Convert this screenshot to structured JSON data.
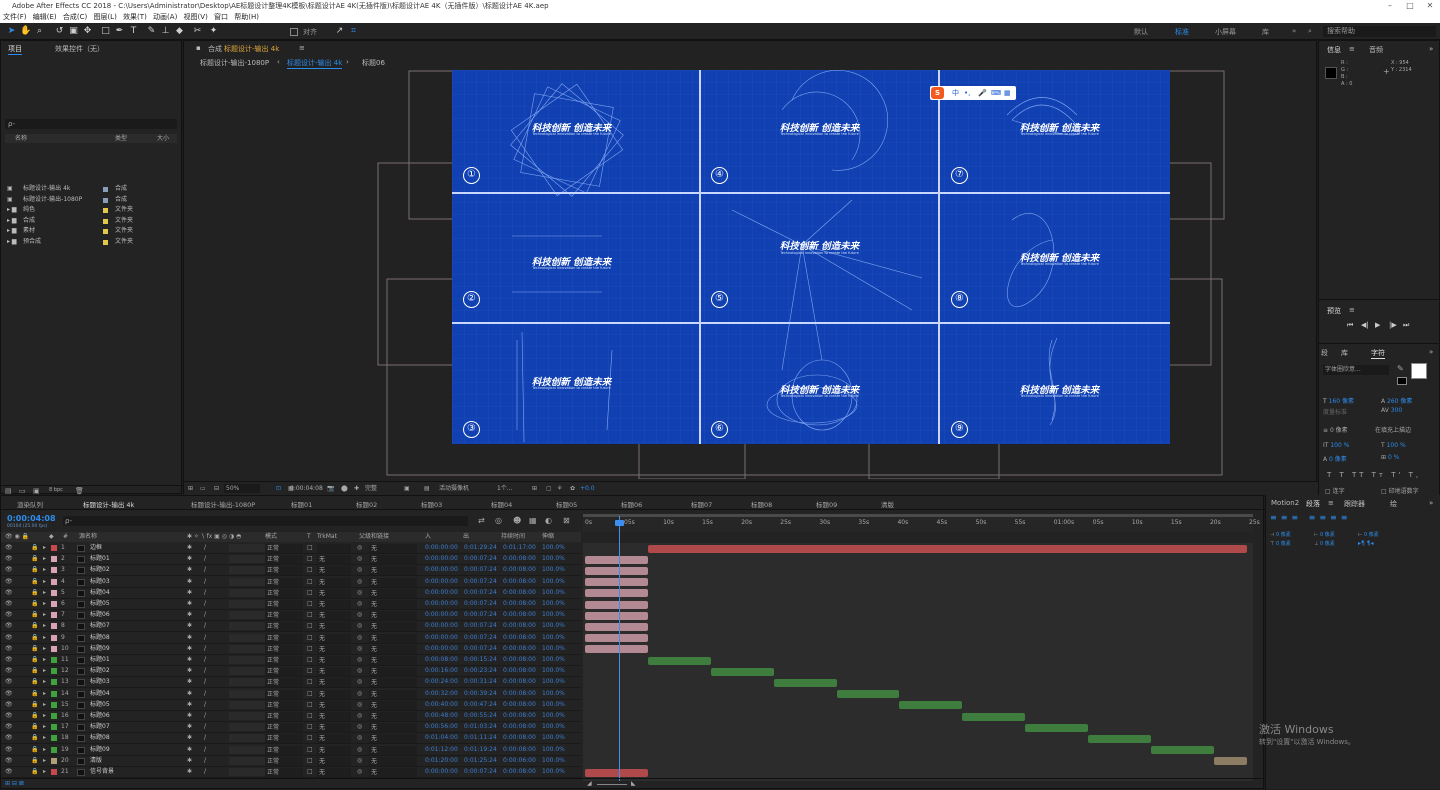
{
  "app": {
    "title": "Adobe After Effects CC 2018 - C:\\Users\\Administrator\\Desktop\\AE标题设计整理4K模板\\标题设计AE 4K(无插件版)\\标题设计AE 4K（无插件版）\\标题设计AE 4K.aep"
  },
  "menu": [
    "文件(F)",
    "编辑(E)",
    "合成(C)",
    "图层(L)",
    "效果(T)",
    "动画(A)",
    "视图(V)",
    "窗口",
    "帮助(H)"
  ],
  "workspace": {
    "items": [
      "默认",
      "标准",
      "小屏幕",
      "库"
    ],
    "active": "标准",
    "search_placeholder": "搜索帮助"
  },
  "toolbar": {
    "align_label": "对齐"
  },
  "project": {
    "tab": "项目",
    "effects_tab": "效果控件（无）",
    "search_placeholder": "ρ-",
    "col_name": "名称",
    "col_type": "类型",
    "col_size": "大小",
    "items": [
      {
        "name": "标题设计-输出 4k",
        "type": "合成",
        "color": "#8a9db8",
        "folder": false
      },
      {
        "name": "标题设计-输出-1080P",
        "type": "合成",
        "color": "#8a9db8",
        "folder": false
      },
      {
        "name": "纯色",
        "type": "文件夹",
        "color": "#e1c84a",
        "folder": true
      },
      {
        "name": "合成",
        "type": "文件夹",
        "color": "#e1c84a",
        "folder": true
      },
      {
        "name": "素材",
        "type": "文件夹",
        "color": "#e1c84a",
        "folder": true
      },
      {
        "name": "预合成",
        "type": "文件夹",
        "color": "#e1c84a",
        "folder": true
      }
    ],
    "bpc": "8 bpc"
  },
  "comp_panel": {
    "tab_prefix": "合成",
    "tab_name": "标题设计-输出 4k",
    "subtabs": [
      "标题设计-输出-1080P",
      "标题设计-输出 4k",
      "标题06"
    ],
    "active_subtab": "标题设计-输出 4k"
  },
  "viewer": {
    "bg": "#1040b2",
    "cells": [
      {
        "n": "①",
        "title": "科技创新 创造未来",
        "sub": "Technological innovation to create the future"
      },
      {
        "n": "④",
        "title": "科技创新 创造未来",
        "sub": "Technological innovation to create the future"
      },
      {
        "n": "⑦",
        "title": "科技创新 创造未来",
        "sub": "Technological innovation to create the future"
      },
      {
        "n": "②",
        "title": "科技创新 创造未来",
        "sub": "Technological innovation to create the future"
      },
      {
        "n": "⑤",
        "title": "科技创新 创造未来",
        "sub": "Technological innovation to create the future"
      },
      {
        "n": "⑧",
        "title": "科技创新 创造未来",
        "sub": "Technological innovation to create the future"
      },
      {
        "n": "③",
        "title": "科技创新 创造未来",
        "sub": "Technological innovation to create the future"
      },
      {
        "n": "⑥",
        "title": "科技创新 创造未来",
        "sub": "Technological innovation to create the future"
      },
      {
        "n": "⑨",
        "title": "科技创新 创造未来",
        "sub": "Technological innovation to create the future"
      }
    ]
  },
  "ime": {
    "label": "中"
  },
  "viewer_bar": {
    "zoom": "50%",
    "time": "0:00:04:08",
    "quality": "完整",
    "camera": "活动摄像机",
    "views": "1个...",
    "exposure": "+0.0"
  },
  "timeline": {
    "tabs": [
      "渲染队列",
      "标题设计-输出 4k",
      "标题设计-输出-1080P",
      "标题01",
      "标题02",
      "标题03",
      "标题04",
      "标题05",
      "标题06",
      "标题07",
      "标题08",
      "标题09",
      "清版"
    ],
    "active_tab": "标题设计-输出 4k",
    "timecode": "0:00:04:08",
    "fps": "00104 (25.00 fps)",
    "search_placeholder": "ρ-",
    "cols": {
      "name": "源名称",
      "mode": "模式",
      "trkmat": "TrkMat",
      "parent": "父级和链接",
      "in": "入",
      "out": "出",
      "dur": "持续时间",
      "stretch": "伸缩"
    },
    "ruler": [
      "0s",
      "05s",
      "10s",
      "15s",
      "20s",
      "25s",
      "30s",
      "35s",
      "40s",
      "45s",
      "50s",
      "55s",
      "01:00s",
      "05s",
      "10s",
      "15s",
      "20s",
      "25s"
    ],
    "layers": [
      {
        "n": "1",
        "name": "边框",
        "color": "#c7494b",
        "mode": "正常",
        "trk": "",
        "parent": "无",
        "in": "0:00:00:00",
        "out": "0:01:29:24",
        "dur": "0:01:17:00",
        "st": "100.0%",
        "bar": [
          0.095,
          1.0
        ],
        "barcolor": "#b04a4a"
      },
      {
        "n": "2",
        "name": "标题01",
        "color": "#d9a3b5",
        "mode": "正常",
        "trk": "无",
        "parent": "无",
        "in": "0:00:00:00",
        "out": "0:00:07:24",
        "dur": "0:00:08:00",
        "st": "100.0%",
        "bar": [
          0.0,
          0.095
        ],
        "barcolor": "#b38993"
      },
      {
        "n": "3",
        "name": "标题02",
        "color": "#d9a3b5",
        "mode": "正常",
        "trk": "无",
        "parent": "无",
        "in": "0:00:00:00",
        "out": "0:00:07:24",
        "dur": "0:00:08:00",
        "st": "100.0%",
        "bar": [
          0.0,
          0.095
        ],
        "barcolor": "#b38993"
      },
      {
        "n": "4",
        "name": "标题03",
        "color": "#d9a3b5",
        "mode": "正常",
        "trk": "无",
        "parent": "无",
        "in": "0:00:00:00",
        "out": "0:00:07:24",
        "dur": "0:00:08:00",
        "st": "100.0%",
        "bar": [
          0.0,
          0.095
        ],
        "barcolor": "#b38993"
      },
      {
        "n": "5",
        "name": "标题04",
        "color": "#d9a3b5",
        "mode": "正常",
        "trk": "无",
        "parent": "无",
        "in": "0:00:00:00",
        "out": "0:00:07:24",
        "dur": "0:00:08:00",
        "st": "100.0%",
        "bar": [
          0.0,
          0.095
        ],
        "barcolor": "#b38993"
      },
      {
        "n": "6",
        "name": "标题05",
        "color": "#d9a3b5",
        "mode": "正常",
        "trk": "无",
        "parent": "无",
        "in": "0:00:00:00",
        "out": "0:00:07:24",
        "dur": "0:00:08:00",
        "st": "100.0%",
        "bar": [
          0.0,
          0.095
        ],
        "barcolor": "#b38993"
      },
      {
        "n": "7",
        "name": "标题06",
        "color": "#d9a3b5",
        "mode": "正常",
        "trk": "无",
        "parent": "无",
        "in": "0:00:00:00",
        "out": "0:00:07:24",
        "dur": "0:00:08:00",
        "st": "100.0%",
        "bar": [
          0.0,
          0.095
        ],
        "barcolor": "#b38993"
      },
      {
        "n": "8",
        "name": "标题07",
        "color": "#d9a3b5",
        "mode": "正常",
        "trk": "无",
        "parent": "无",
        "in": "0:00:00:00",
        "out": "0:00:07:24",
        "dur": "0:00:08:00",
        "st": "100.0%",
        "bar": [
          0.0,
          0.095
        ],
        "barcolor": "#b38993"
      },
      {
        "n": "9",
        "name": "标题08",
        "color": "#d9a3b5",
        "mode": "正常",
        "trk": "无",
        "parent": "无",
        "in": "0:00:00:00",
        "out": "0:00:07:24",
        "dur": "0:00:08:00",
        "st": "100.0%",
        "bar": [
          0.0,
          0.095
        ],
        "barcolor": "#b38993"
      },
      {
        "n": "10",
        "name": "标题09",
        "color": "#d9a3b5",
        "mode": "正常",
        "trk": "无",
        "parent": "无",
        "in": "0:00:00:00",
        "out": "0:00:07:24",
        "dur": "0:00:08:00",
        "st": "100.0%",
        "bar": [
          0.0,
          0.095
        ],
        "barcolor": "#b38993"
      },
      {
        "n": "11",
        "name": "标题01",
        "color": "#3fa23f",
        "mode": "正常",
        "trk": "无",
        "parent": "无",
        "in": "0:00:08:00",
        "out": "0:00:15:24",
        "dur": "0:00:08:00",
        "st": "100.0%",
        "bar": [
          0.095,
          0.19
        ],
        "barcolor": "#3f7d3f"
      },
      {
        "n": "12",
        "name": "标题02",
        "color": "#3fa23f",
        "mode": "正常",
        "trk": "无",
        "parent": "无",
        "in": "0:00:16:00",
        "out": "0:00:23:24",
        "dur": "0:00:08:00",
        "st": "100.0%",
        "bar": [
          0.19,
          0.285
        ],
        "barcolor": "#3f7d3f"
      },
      {
        "n": "13",
        "name": "标题03",
        "color": "#3fa23f",
        "mode": "正常",
        "trk": "无",
        "parent": "无",
        "in": "0:00:24:00",
        "out": "0:00:31:24",
        "dur": "0:00:08:00",
        "st": "100.0%",
        "bar": [
          0.285,
          0.38
        ],
        "barcolor": "#3f7d3f"
      },
      {
        "n": "14",
        "name": "标题04",
        "color": "#3fa23f",
        "mode": "正常",
        "trk": "无",
        "parent": "无",
        "in": "0:00:32:00",
        "out": "0:00:39:24",
        "dur": "0:00:08:00",
        "st": "100.0%",
        "bar": [
          0.38,
          0.475
        ],
        "barcolor": "#3f7d3f"
      },
      {
        "n": "15",
        "name": "标题05",
        "color": "#3fa23f",
        "mode": "正常",
        "trk": "无",
        "parent": "无",
        "in": "0:00:40:00",
        "out": "0:00:47:24",
        "dur": "0:00:08:00",
        "st": "100.0%",
        "bar": [
          0.475,
          0.57
        ],
        "barcolor": "#3f7d3f"
      },
      {
        "n": "16",
        "name": "标题06",
        "color": "#3fa23f",
        "mode": "正常",
        "trk": "无",
        "parent": "无",
        "in": "0:00:48:00",
        "out": "0:00:55:24",
        "dur": "0:00:08:00",
        "st": "100.0%",
        "bar": [
          0.57,
          0.665
        ],
        "barcolor": "#3f7d3f"
      },
      {
        "n": "17",
        "name": "标题07",
        "color": "#3fa23f",
        "mode": "正常",
        "trk": "无",
        "parent": "无",
        "in": "0:00:56:00",
        "out": "0:01:03:24",
        "dur": "0:00:08:00",
        "st": "100.0%",
        "bar": [
          0.665,
          0.76
        ],
        "barcolor": "#3f7d3f"
      },
      {
        "n": "18",
        "name": "标题08",
        "color": "#3fa23f",
        "mode": "正常",
        "trk": "无",
        "parent": "无",
        "in": "0:01:04:00",
        "out": "0:01:11:24",
        "dur": "0:00:08:00",
        "st": "100.0%",
        "bar": [
          0.76,
          0.855
        ],
        "barcolor": "#3f7d3f"
      },
      {
        "n": "19",
        "name": "标题09",
        "color": "#3fa23f",
        "mode": "正常",
        "trk": "无",
        "parent": "无",
        "in": "0:01:12:00",
        "out": "0:01:19:24",
        "dur": "0:00:08:00",
        "st": "100.0%",
        "bar": [
          0.855,
          0.95
        ],
        "barcolor": "#3f7d3f"
      },
      {
        "n": "20",
        "name": "清版",
        "color": "#b0a07a",
        "mode": "正常",
        "trk": "无",
        "parent": "无",
        "in": "0:01:20:00",
        "out": "0:01:25:24",
        "dur": "0:00:06:00",
        "st": "100.0%",
        "bar": [
          0.95,
          1.0
        ],
        "barcolor": "#8c7c63"
      },
      {
        "n": "21",
        "name": "信号背景",
        "color": "#c7494b",
        "mode": "正常",
        "trk": "无",
        "parent": "无",
        "in": "0:00:00:00",
        "out": "0:00:07:24",
        "dur": "0:00:08:00",
        "st": "100.0%",
        "bar": [
          0.0,
          0.095
        ],
        "barcolor": "#b04a4a"
      }
    ]
  },
  "info": {
    "tabs": [
      "信息",
      "音频"
    ],
    "rgb": [
      "R :",
      "G :",
      "B :",
      "A : 0"
    ],
    "x": "X : 954",
    "y": "Y : 2314"
  },
  "preview": {
    "tab": "预览"
  },
  "character": {
    "tabs": [
      "段",
      "库",
      "字符"
    ],
    "font": "字体圈欣意...",
    "size": "160 像素",
    "leading": "260 像素",
    "tracking": "0 像素",
    "stroke": "在填充上描边",
    "scale_v": "100 %",
    "scale_h": "100 %",
    "baseline": "0 像素",
    "tsume": "0 %",
    "opt1": "连字",
    "opt2": "印地语数字",
    "kerning": "度量标准",
    "track_val": "300"
  },
  "paragraph": {
    "tabs": [
      "Motion2",
      "段落",
      "跟踪器",
      "绘"
    ],
    "indent": "0 像素"
  },
  "activation": {
    "line1": "激活 Windows",
    "line2": "转到\"设置\"以激活 Windows。"
  }
}
